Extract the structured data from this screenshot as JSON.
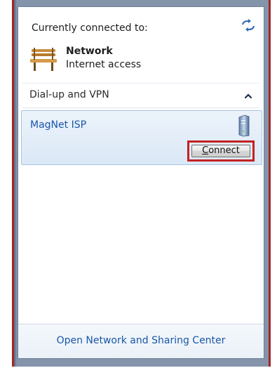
{
  "connected_section": {
    "header": "Currently connected to:",
    "network_name": "Network",
    "network_status": "Internet access",
    "icons": {
      "refresh": "refresh-icon",
      "network": "park-bench-icon"
    }
  },
  "dialup_section": {
    "header": "Dial-up and VPN",
    "collapse_icon": "chevron-up-icon",
    "connections": [
      {
        "name": "MagNet ISP",
        "icon": "dialup-modem-icon",
        "action_label": "Connect",
        "action_accesskey": "C"
      }
    ]
  },
  "footer": {
    "link_text": "Open Network and Sharing Center"
  },
  "colors": {
    "link_blue": "#1a56a8",
    "highlight_red": "#c22222",
    "selected_item_bg": "#dbe8f6",
    "window_border": "#8494ab"
  }
}
